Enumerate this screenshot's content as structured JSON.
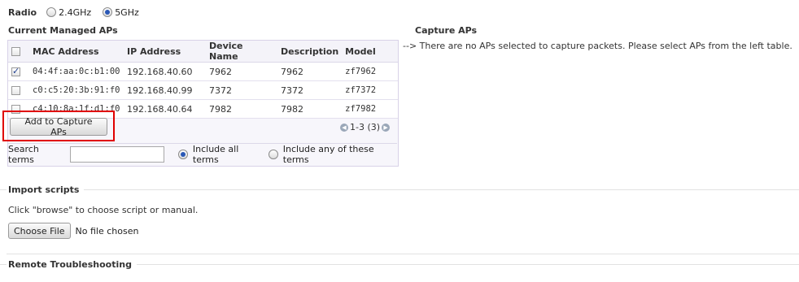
{
  "radio": {
    "label": "Radio",
    "options": [
      {
        "label": "2.4GHz",
        "checked": false
      },
      {
        "label": "5GHz",
        "checked": true
      }
    ]
  },
  "managed": {
    "title": "Current Managed APs",
    "columns": [
      "MAC Address",
      "IP Address",
      "Device Name",
      "Description",
      "Model"
    ],
    "rows": [
      {
        "checked": true,
        "mac": "04:4f:aa:0c:b1:00",
        "ip": "192.168.40.60",
        "device": "7962",
        "desc": "7962",
        "model": "zf7962"
      },
      {
        "checked": false,
        "mac": "c0:c5:20:3b:91:f0",
        "ip": "192.168.40.99",
        "device": "7372",
        "desc": "7372",
        "model": "zf7372"
      },
      {
        "checked": false,
        "mac": "c4:10:8a:1f:d1:f0",
        "ip": "192.168.40.64",
        "device": "7982",
        "desc": "7982",
        "model": "zf7982"
      }
    ],
    "add_button": "Add to Capture APs",
    "pager": "1-3 (3)",
    "search_label": "Search terms",
    "search_value": "",
    "include_all": "Include all terms",
    "include_any": "Include any of these terms"
  },
  "capture": {
    "title": "Capture APs",
    "message": "--> There are no APs selected to capture packets. Please select APs from the left table."
  },
  "import": {
    "title": "Import scripts",
    "hint": "Click \"browse\" to choose script or manual.",
    "choose_button": "Choose File",
    "file_status": "No file chosen"
  },
  "remote": {
    "title": "Remote Troubleshooting"
  },
  "colors": {
    "highlight": "#e00000",
    "accent_radio": "#2a58b6"
  }
}
